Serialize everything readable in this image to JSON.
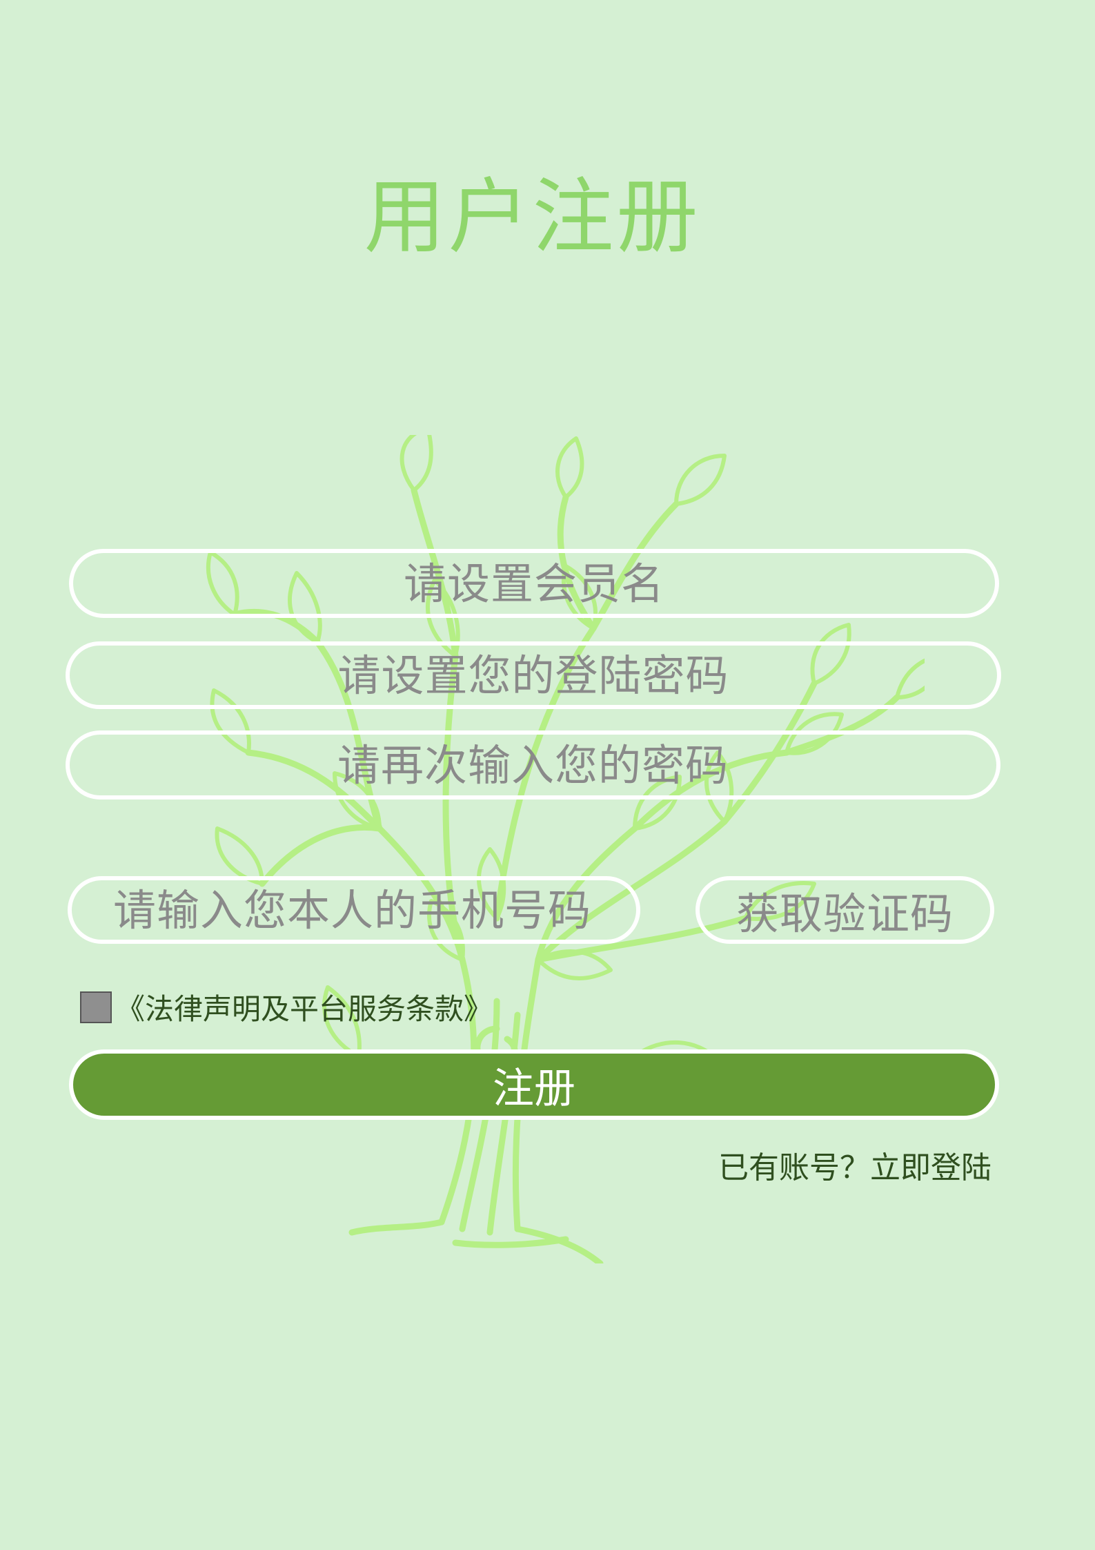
{
  "page": {
    "title": "用户注册"
  },
  "form": {
    "username_placeholder": "请设置会员名",
    "password_placeholder": "请设置您的登陆密码",
    "confirm_password_placeholder": "请再次输入您的密码",
    "phone_placeholder": "请输入您本人的手机号码",
    "get_code_label": "获取验证码",
    "terms_label": "《法律声明及平台服务条款》",
    "terms_checked": false,
    "register_label": "注册",
    "login_link_label": "已有账号？立即登陆"
  },
  "colors": {
    "background": "#d5f0d3",
    "title": "#8fd66b",
    "register_button": "#659b35",
    "tree": "#b5ef85"
  },
  "icons": {
    "background_illustration": "tree-illustration"
  }
}
